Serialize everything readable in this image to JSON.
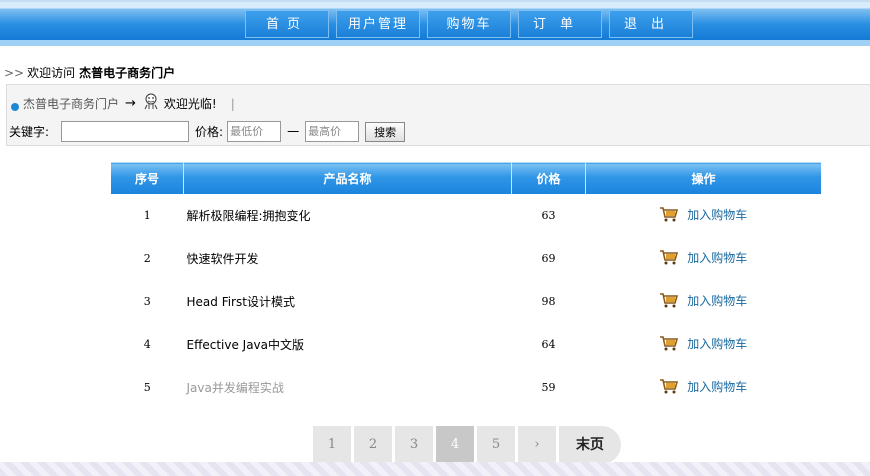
{
  "nav": {
    "items": [
      "首页",
      "用户管理",
      "购物车",
      "订单",
      "退出"
    ]
  },
  "welcome": {
    "prefix": "欢迎访问",
    "site": "杰普电子商务门户"
  },
  "crumb": {
    "site": "杰普电子商务门户",
    "hello": "欢迎光临!",
    "sep": "|"
  },
  "filter": {
    "keyword_label": "关键字:",
    "keyword_value": "",
    "price_label": "价格:",
    "min_placeholder": "最低价",
    "dash": "一",
    "max_placeholder": "最高价",
    "search_button": "搜索"
  },
  "table": {
    "headers": [
      "序号",
      "产品名称",
      "价格",
      "操作"
    ],
    "rows": [
      {
        "idx": "1",
        "name": "解析极限编程:拥抱变化",
        "price": "63",
        "action": "加入购物车"
      },
      {
        "idx": "2",
        "name": "快速软件开发",
        "price": "69",
        "action": "加入购物车"
      },
      {
        "idx": "3",
        "name": "Head First设计模式",
        "price": "98",
        "action": "加入购物车"
      },
      {
        "idx": "4",
        "name": "Effective Java中文版",
        "price": "64",
        "action": "加入购物车"
      },
      {
        "idx": "5",
        "name": "Java并发编程实战",
        "price": "59",
        "action": "加入购物车"
      }
    ]
  },
  "pager": {
    "pages": [
      "1",
      "2",
      "3",
      "4",
      "5"
    ],
    "active_page": "4",
    "next": "›",
    "last": "末页"
  },
  "colors": {
    "nav_blue": "#1a7fd8",
    "header_blue": "#2f95e6",
    "link_blue": "#1a6aa0"
  }
}
